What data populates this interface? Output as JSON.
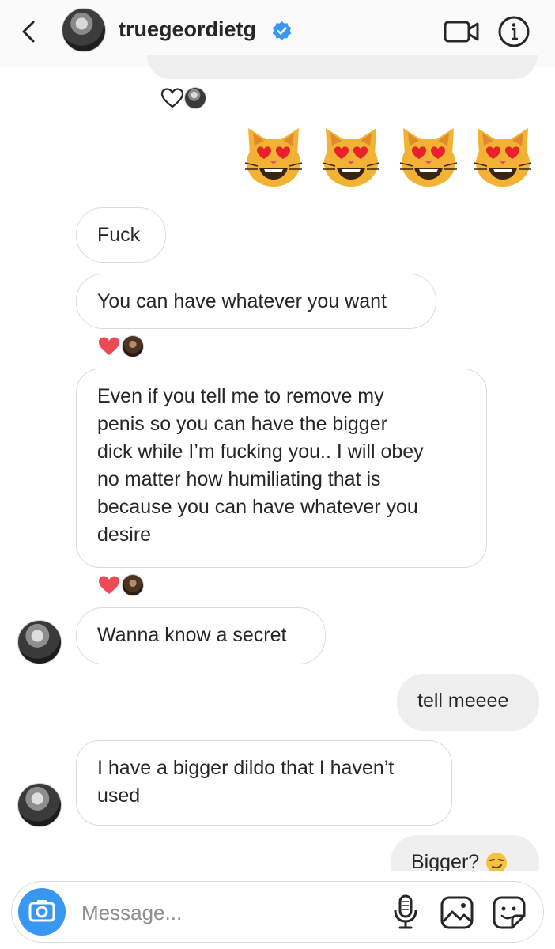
{
  "header": {
    "username": "truegeordietg",
    "icons": [
      "back-arrow-icon",
      "verified-badge-icon",
      "video-call-icon",
      "info-icon"
    ]
  },
  "thread": {
    "messages": [
      {
        "id": "m1",
        "from": "them",
        "text": "Fuck"
      },
      {
        "id": "m2",
        "from": "them",
        "text": "You can have whatever you want",
        "reaction": "heart"
      },
      {
        "id": "m3",
        "from": "them",
        "text": "Even if you tell me to remove my\npenis so you can have the bigger\ndick while I’m fucking you.. I will obey\nno matter how humiliating that is\nbecause you can have whatever you\ndesire",
        "reaction": "heart"
      },
      {
        "id": "m4",
        "from": "them",
        "text": "Wanna know a secret"
      },
      {
        "id": "m5",
        "from": "me",
        "text": "tell meeee"
      },
      {
        "id": "m6",
        "from": "them",
        "text": "I have a bigger dildo that I haven’t\nused"
      },
      {
        "id": "m7",
        "from": "me",
        "text": "Bigger?"
      }
    ],
    "sent_emoji": [
      "heart-eyes-cat",
      "heart-eyes-cat",
      "heart-eyes-cat",
      "heart-eyes-cat"
    ],
    "colors": {
      "heart": "#ed4956",
      "outgoing_bubble": "#efefef",
      "incoming_border": "#dbdbdb"
    }
  },
  "composer": {
    "placeholder": "Message...",
    "icons": [
      "camera-icon",
      "microphone-icon",
      "gallery-icon",
      "sticker-icon"
    ],
    "accent": "#3897f0"
  }
}
